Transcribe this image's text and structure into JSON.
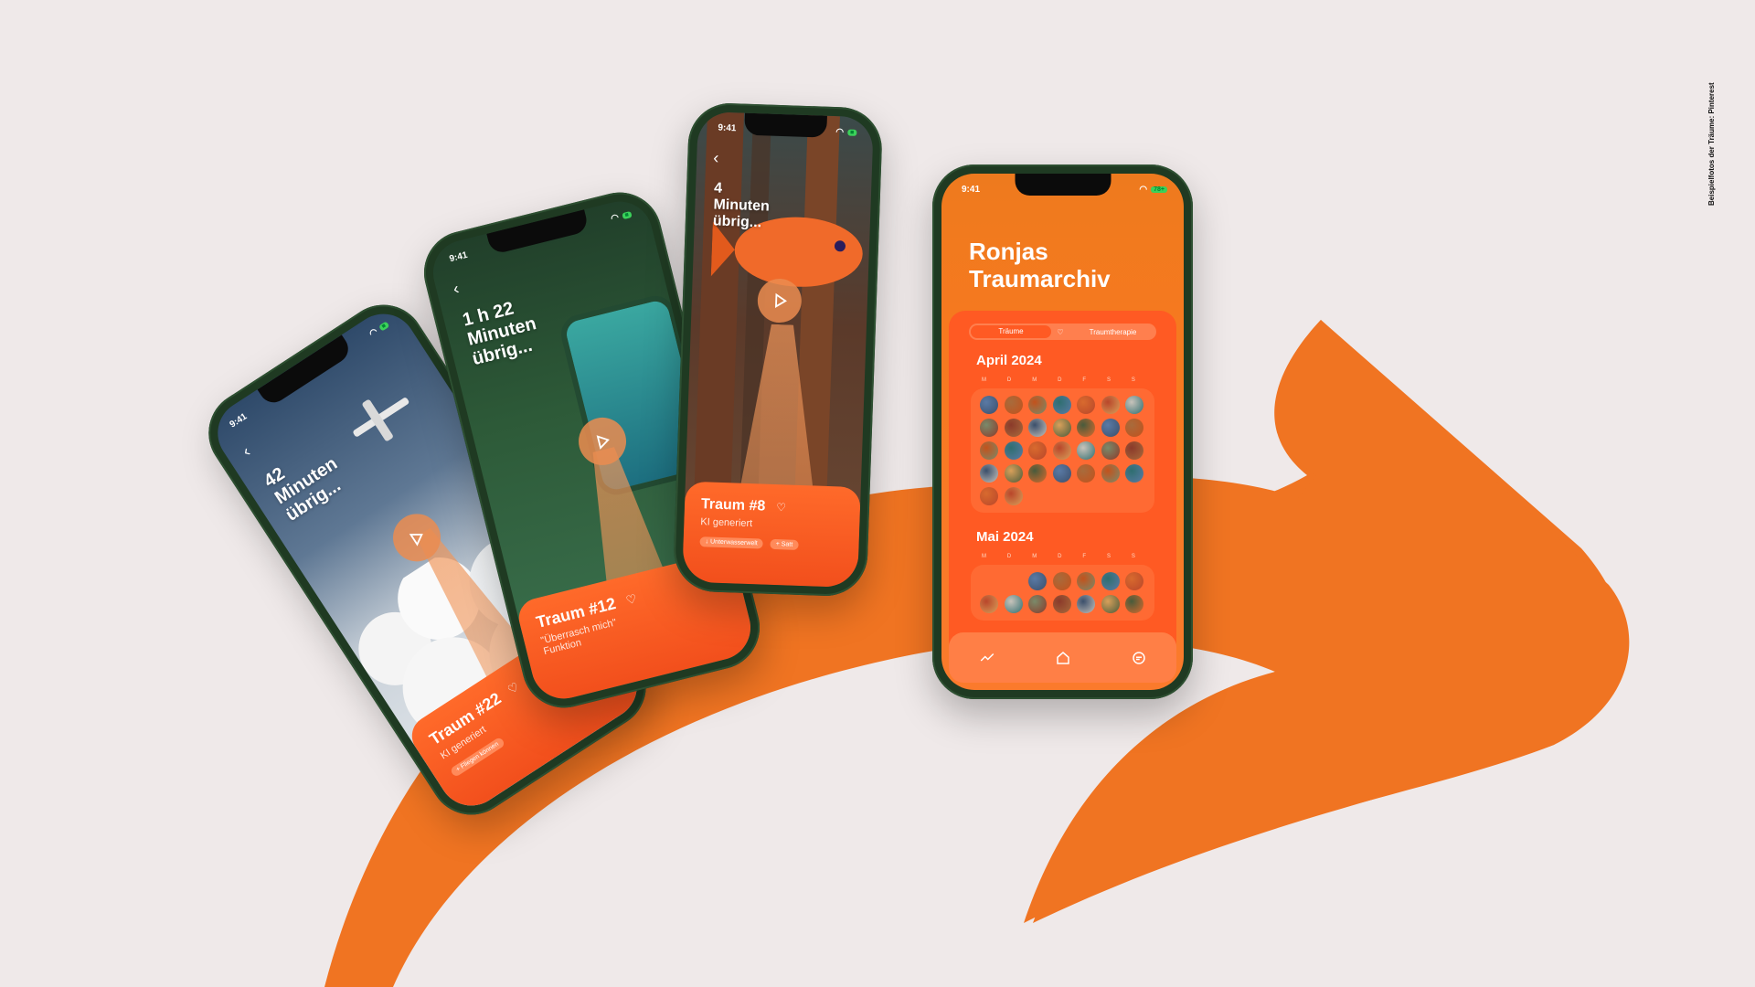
{
  "credit_text": "Beispielfotos der Träume: Pinterest",
  "colors": {
    "accent": "#f07422",
    "card": "#f24f1c",
    "phone": "#1f3a22"
  },
  "phones": [
    {
      "status_time": "9:41",
      "time_left": "42 Minuten übrig...",
      "card_title": "Traum #22",
      "card_sub": "KI generiert",
      "chips": [
        "+ Fliegen können"
      ]
    },
    {
      "status_time": "9:41",
      "time_left": "1 h 22 Minuten übrig...",
      "card_title": "Traum #12",
      "card_sub": "\"Überrasch mich\" Funktion",
      "chips": []
    },
    {
      "status_time": "9:41",
      "time_left": "4 Minuten übrig...",
      "card_title": "Traum #8",
      "card_sub": "KI generiert",
      "chips": [
        "↓ Unterwasserwelt",
        "+ Satt"
      ]
    }
  ],
  "archive": {
    "status_time": "9:41",
    "battery": "78+",
    "title": "Ronjas Traumarchiv",
    "tabs": [
      "Träume",
      "Traumtherapie"
    ],
    "months": [
      {
        "label": "April 2024",
        "weekdays": [
          "M",
          "D",
          "M",
          "D",
          "F",
          "S",
          "S"
        ],
        "day_count": 30
      },
      {
        "label": "Mai 2024",
        "weekdays": [
          "M",
          "D",
          "M",
          "D",
          "F",
          "S",
          "S"
        ],
        "day_count": 12
      }
    ],
    "nav": [
      "stats-icon",
      "home-icon",
      "chat-icon"
    ]
  }
}
